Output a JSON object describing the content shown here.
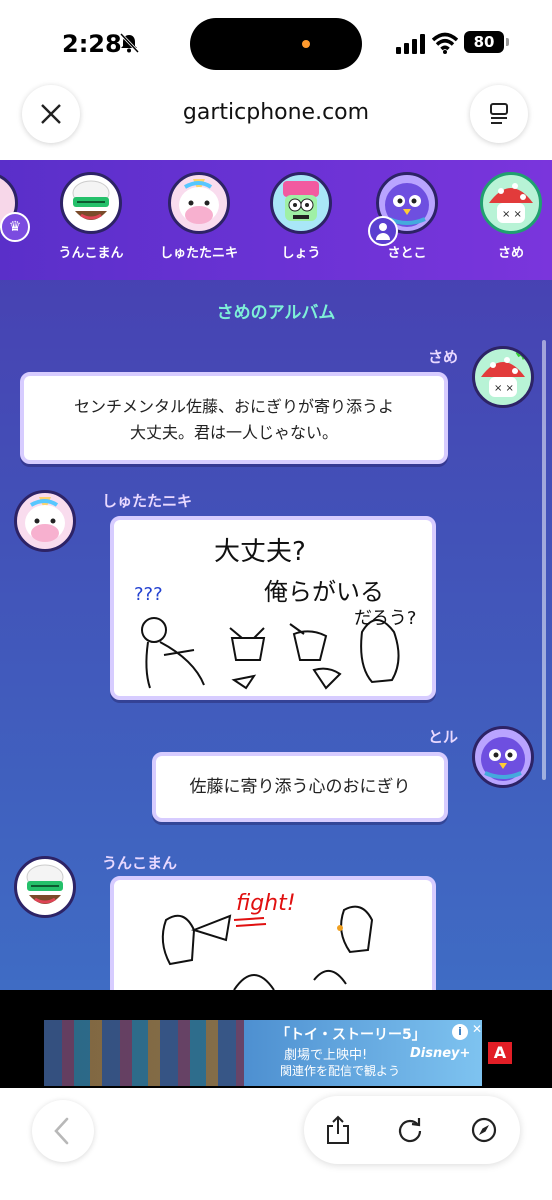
{
  "status_bar": {
    "time": "2:28",
    "battery": "80"
  },
  "browser": {
    "url": "garticphone.com"
  },
  "players": [
    {
      "name": "うんこまん"
    },
    {
      "name": "しゅたたニキ"
    },
    {
      "name": "しょう"
    },
    {
      "name": "さとこ"
    },
    {
      "name": "さめ"
    }
  ],
  "album": {
    "title": "さめのアルバム",
    "messages": [
      {
        "author": "さめ",
        "text_line1": "センチメンタル佐藤、おにぎりが寄り添うよ",
        "text_line2": "大丈夫。君は一人じゃない。"
      },
      {
        "author": "しゅたたニキ",
        "drawing_text_1": "大丈夫?",
        "drawing_text_2": "俺らがいる",
        "drawing_text_3": "だろう?",
        "drawing_text_4": "???"
      },
      {
        "author": "とル",
        "text": "佐藤に寄り添う心のおにぎり"
      },
      {
        "author": "うんこまん",
        "drawing_text_1": "fight!"
      }
    ]
  },
  "ad": {
    "line1": "「トイ・ストーリー5」",
    "line2": "劇場で上映中!",
    "line3": "関連作を配信で観よう",
    "brand": "Disney+",
    "info": "i",
    "close": "✕",
    "badge": "A"
  },
  "colors": {
    "accent_teal": "#7ef0d8",
    "strip_purple": "#6a32d4",
    "ad_red": "#e21e26"
  }
}
